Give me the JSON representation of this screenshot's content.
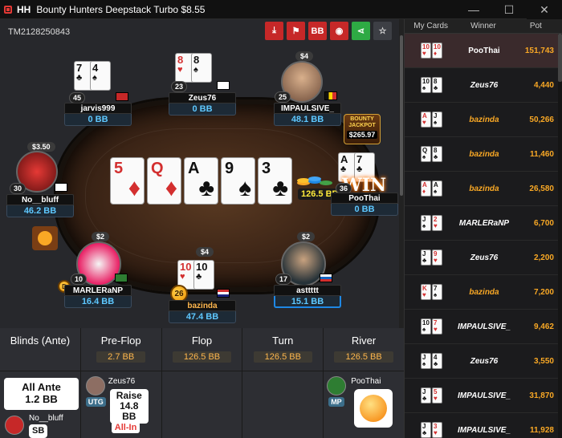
{
  "window": {
    "title": "Bounty Hunters Deepstack Turbo $8.55",
    "app": "HH",
    "minimize": "—",
    "maximize": "☐",
    "close": "✕"
  },
  "hand_id": "TM2128250843",
  "toolbar": {
    "download": "⤓",
    "flag": "⚑",
    "bb": "BB",
    "spy": "◉",
    "share": "⋖",
    "star": "☆"
  },
  "board": [
    {
      "rank": "5",
      "suit": "♦",
      "red": true
    },
    {
      "rank": "Q",
      "suit": "♦",
      "red": true
    },
    {
      "rank": "A",
      "suit": "♣",
      "red": false
    },
    {
      "rank": "9",
      "suit": "♠",
      "red": false
    },
    {
      "rank": "3",
      "suit": "♣",
      "red": false
    }
  ],
  "pot": "126.5 BB",
  "jackpot": {
    "line1": "BOUNTY",
    "line2": "JACKPOT",
    "amount": "$265.97"
  },
  "win_text": "WIN",
  "seats": {
    "jarvis": {
      "name": "jarvis999",
      "stack": "0 BB",
      "level": "45",
      "c1": "7",
      "s1": "♣",
      "c2": "4",
      "s2": "♠"
    },
    "zeus": {
      "name": "Zeus76",
      "stack": "0 BB",
      "level": "23",
      "c1": "8",
      "s1": "♥",
      "c2": "8",
      "s2": "♠"
    },
    "impaulsive": {
      "name": "IMPAULSIVE_",
      "stack": "48.1 BB",
      "level": "25",
      "bounty": "$4"
    },
    "noobluff": {
      "name": "No__bluff",
      "stack": "46.2 BB",
      "level": "30",
      "bounty": "$3.50"
    },
    "poothai": {
      "name": "PooThai",
      "stack": "0 BB",
      "level": "36",
      "c1": "A",
      "s1": "♣",
      "c2": "7",
      "s2": "♣"
    },
    "marlera": {
      "name": "MARLERaNP",
      "stack": "16.4 BB",
      "level": "10",
      "bounty": "$2"
    },
    "bazinda": {
      "name": "bazinda",
      "stack": "47.4 BB",
      "level": "26",
      "bounty": "$4",
      "c1": "10",
      "s1": "♥",
      "c2": "10",
      "s2": "♣"
    },
    "asttttt": {
      "name": "asttttt",
      "stack": "15.1 BB",
      "level": "17",
      "bounty": "$2"
    }
  },
  "streets": [
    {
      "name": "Blinds (Ante)",
      "value": ""
    },
    {
      "name": "Pre-Flop",
      "value": "2.7 BB"
    },
    {
      "name": "Flop",
      "value": "126.5 BB"
    },
    {
      "name": "Turn",
      "value": "126.5 BB"
    },
    {
      "name": "River",
      "value": "126.5 BB"
    }
  ],
  "actions": {
    "ante_label": "All Ante",
    "ante_value": "1.2 BB",
    "sb_player": "No__bluff",
    "sb_label": "SB",
    "utg_player": "Zeus76",
    "utg_pos": "UTG",
    "raise_label": "Raise",
    "raise_value": "14.8 BB",
    "allin_label": "All-In",
    "mp_player": "PooThai",
    "mp_pos": "MP"
  },
  "sidebar": {
    "headers": [
      "My Cards",
      "Winner",
      "Pot"
    ],
    "rows": [
      {
        "c1": "10",
        "s1": "♥",
        "r1": true,
        "c2": "10",
        "s2": "♦",
        "r2": true,
        "winner": "PooThai",
        "gold": false,
        "pot": "151,743"
      },
      {
        "c1": "10",
        "s1": "♠",
        "r1": false,
        "c2": "8",
        "s2": "♣",
        "r2": false,
        "winner": "Zeus76",
        "gold": false,
        "pot": "4,440"
      },
      {
        "c1": "A",
        "s1": "♥",
        "r1": true,
        "c2": "J",
        "s2": "♠",
        "r2": false,
        "winner": "bazinda",
        "gold": true,
        "pot": "50,266"
      },
      {
        "c1": "Q",
        "s1": "♠",
        "r1": false,
        "c2": "8",
        "s2": "♣",
        "r2": false,
        "winner": "bazinda",
        "gold": true,
        "pot": "11,460"
      },
      {
        "c1": "A",
        "s1": "♦",
        "r1": true,
        "c2": "A",
        "s2": "♠",
        "r2": false,
        "winner": "bazinda",
        "gold": true,
        "pot": "26,580"
      },
      {
        "c1": "J",
        "s1": "♠",
        "r1": false,
        "c2": "2",
        "s2": "♥",
        "r2": true,
        "winner": "MARLERaNP",
        "gold": false,
        "pot": "6,700"
      },
      {
        "c1": "J",
        "s1": "♣",
        "r1": false,
        "c2": "9",
        "s2": "♥",
        "r2": true,
        "winner": "Zeus76",
        "gold": false,
        "pot": "2,200"
      },
      {
        "c1": "K",
        "s1": "♥",
        "r1": true,
        "c2": "7",
        "s2": "♠",
        "r2": false,
        "winner": "bazinda",
        "gold": true,
        "pot": "7,200"
      },
      {
        "c1": "10",
        "s1": "♠",
        "r1": false,
        "c2": "7",
        "s2": "♥",
        "r2": true,
        "winner": "IMPAULSIVE_",
        "gold": false,
        "pot": "9,462"
      },
      {
        "c1": "J",
        "s1": "♠",
        "r1": false,
        "c2": "4",
        "s2": "♣",
        "r2": false,
        "winner": "Zeus76",
        "gold": false,
        "pot": "3,550"
      },
      {
        "c1": "J",
        "s1": "♣",
        "r1": false,
        "c2": "5",
        "s2": "♥",
        "r2": true,
        "winner": "IMPAULSIVE_",
        "gold": false,
        "pot": "31,870"
      },
      {
        "c1": "J",
        "s1": "♣",
        "r1": false,
        "c2": "3",
        "s2": "♥",
        "r2": true,
        "winner": "IMPAULSIVE_",
        "gold": false,
        "pot": "11,928"
      }
    ]
  }
}
